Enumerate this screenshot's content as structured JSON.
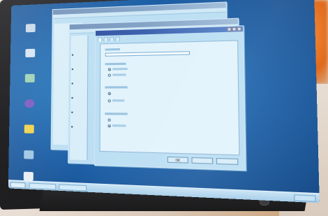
{
  "scene": {
    "description_colors": {
      "desktop": "#1d5fa6",
      "window": "#bcdff3",
      "bezel": "#232325",
      "background_accent": "#e06a1c"
    }
  },
  "desktop_icons": [
    {
      "name": "computer-icon",
      "label": ""
    },
    {
      "name": "network-icon",
      "label": ""
    },
    {
      "name": "recycle-icon",
      "label": ""
    },
    {
      "name": "internet-icon",
      "label": ""
    },
    {
      "name": "folder-icon",
      "label": ""
    },
    {
      "name": "briefcase-icon",
      "label": ""
    },
    {
      "name": "document-icon",
      "label": ""
    }
  ],
  "windows": {
    "back_title": "",
    "mid_title": "",
    "front_title": ""
  },
  "dialog": {
    "tabs": [
      "",
      "",
      "",
      ""
    ],
    "buttons": [
      "OK",
      "",
      ""
    ]
  }
}
